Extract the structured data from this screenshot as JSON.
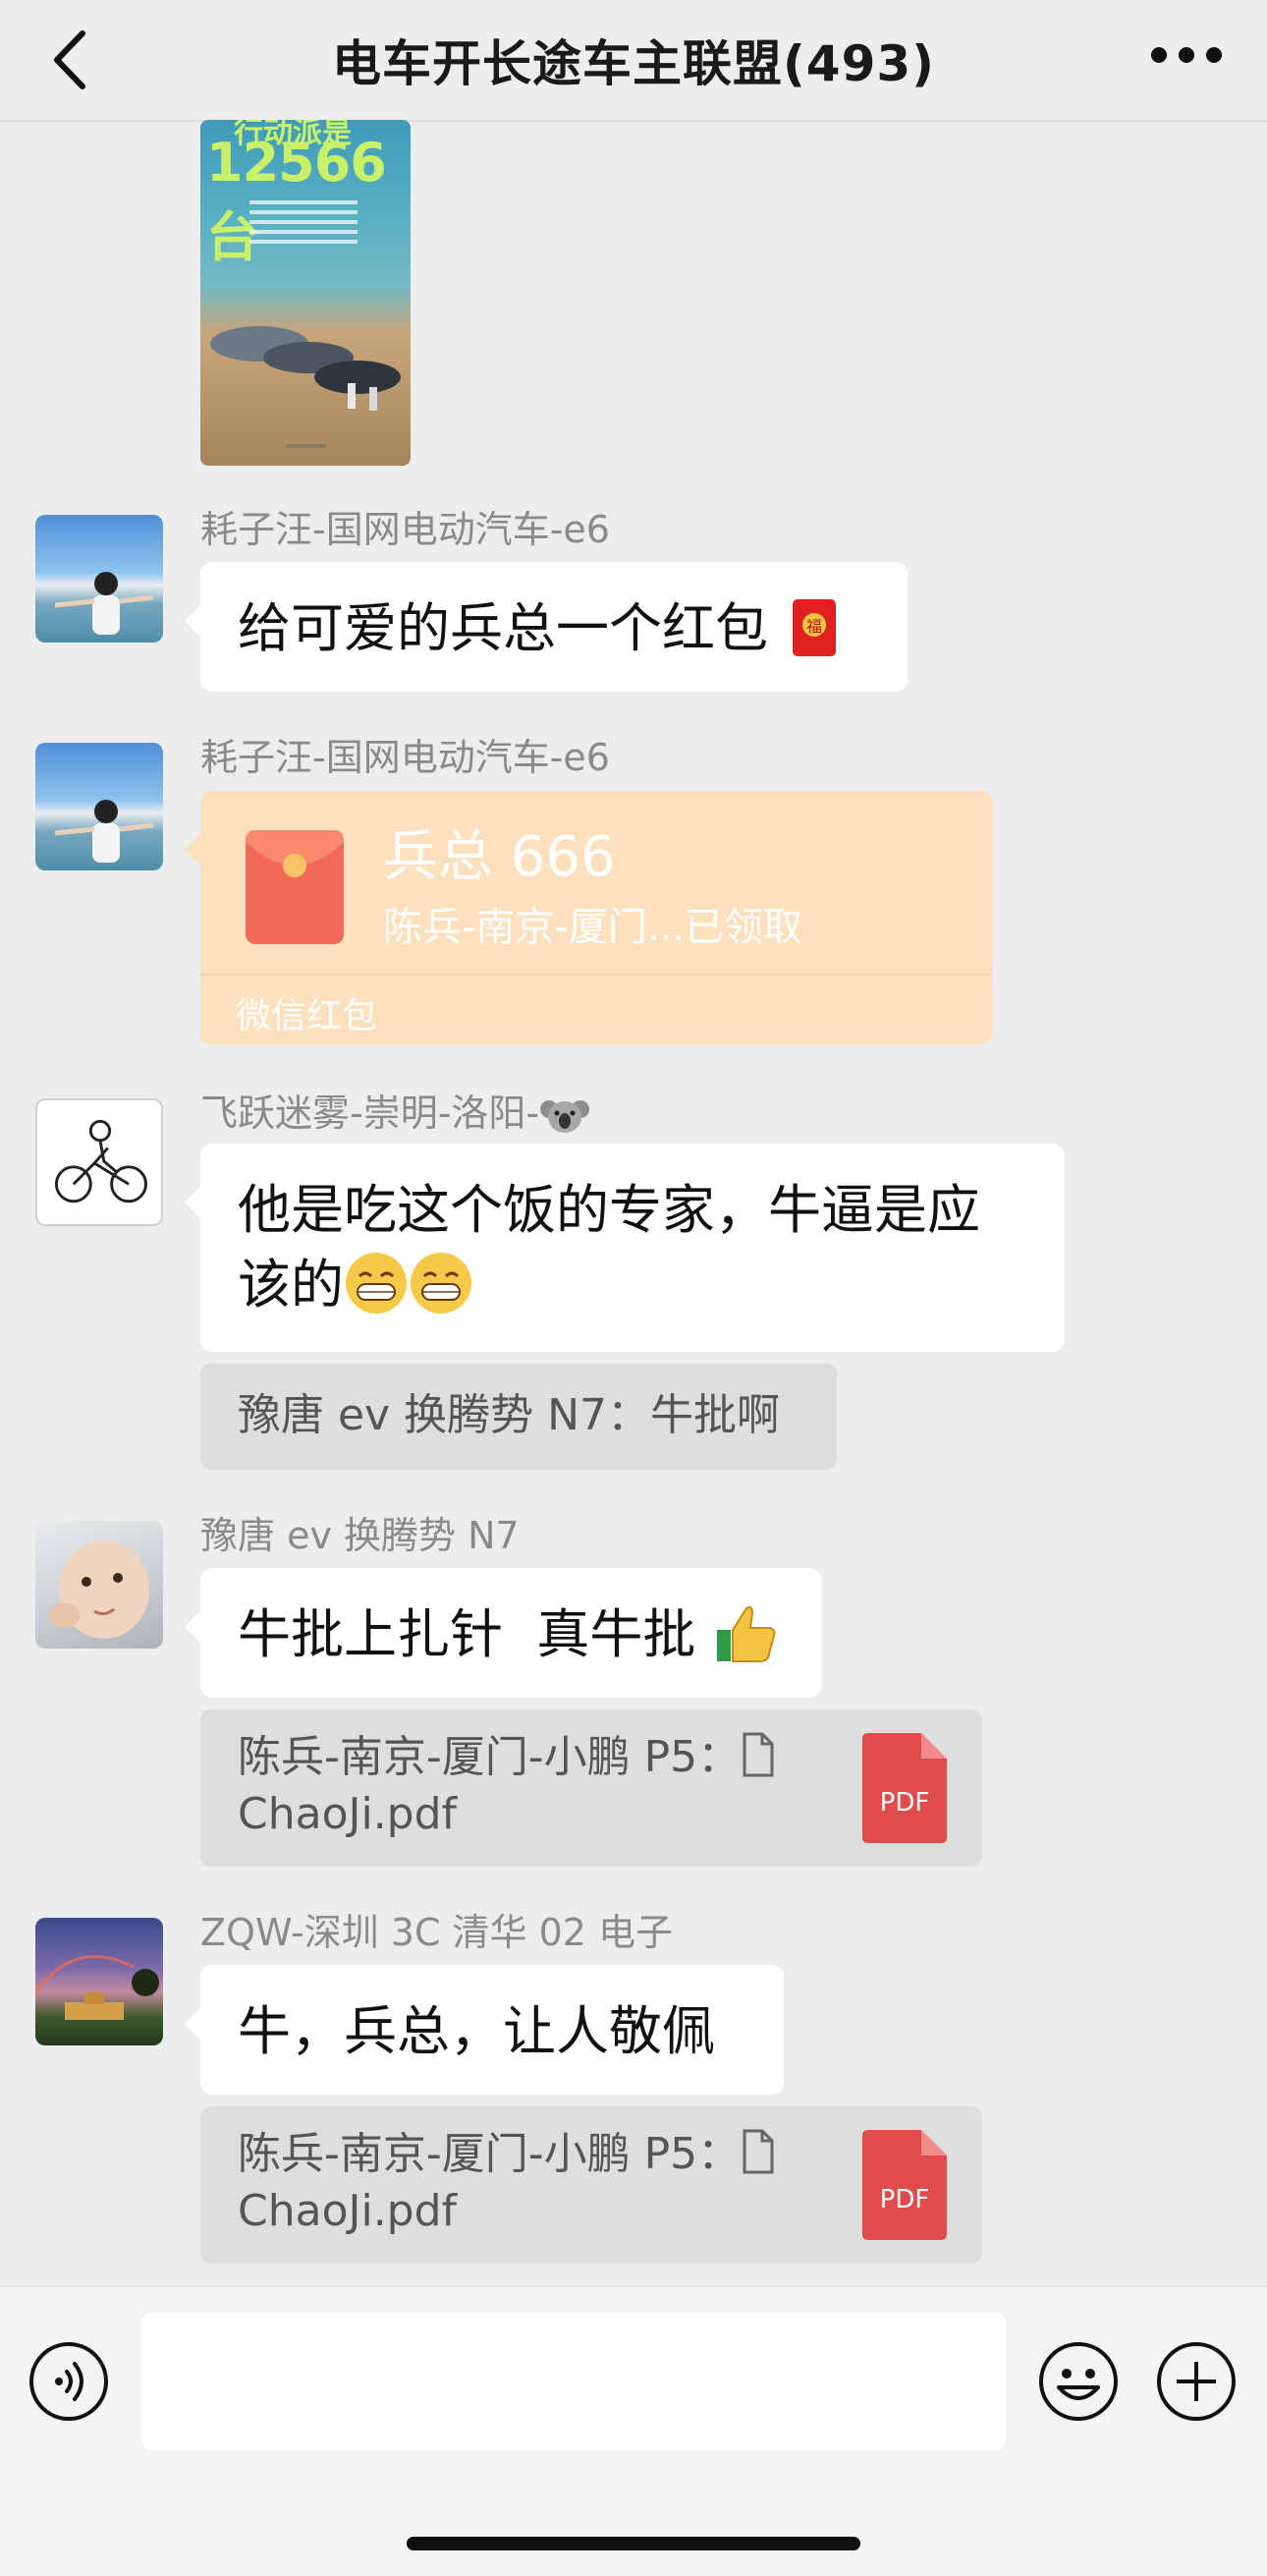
{
  "header": {
    "title": "电车开长途车主联盟(493)"
  },
  "image_message": {
    "poster_line1": "行动派是",
    "poster_number": "12566台"
  },
  "messages": [
    {
      "sender": "耗子汪-国网电动汽车-e6",
      "text": "给可爱的兵总一个红包",
      "emoji": "red-envelope"
    },
    {
      "sender": "耗子汪-国网电动汽车-e6",
      "red_packet": {
        "title": "兵总 666",
        "status": "陈兵-南京-厦门...已领取",
        "label": "微信红包"
      }
    },
    {
      "sender": "飞跃迷雾-崇明-洛阳-",
      "text_line1": "他是吃这个饭的专家，牛逼是应",
      "text_line2": "该的",
      "quote": "豫唐 ev 换腾势 N7：牛批啊"
    },
    {
      "sender": "豫唐 ev 换腾势 N7",
      "text": "牛批上扎针  真牛批",
      "file": {
        "line1": "陈兵-南京-厦门-小鹏 P5：",
        "line2": "ChaoJi.pdf",
        "badge": "PDF"
      }
    },
    {
      "sender": "ZQW-深圳 3C 清华 02 电子",
      "text": "牛，兵总，让人敬佩",
      "file": {
        "line1": "陈兵-南京-厦门-小鹏 P5：",
        "line2": "ChaoJi.pdf",
        "badge": "PDF"
      }
    }
  ],
  "colors": {
    "background": "#ededed",
    "bubble": "#ffffff",
    "red_packet": "#fde0bd",
    "pdf_red": "#e14b4b"
  }
}
